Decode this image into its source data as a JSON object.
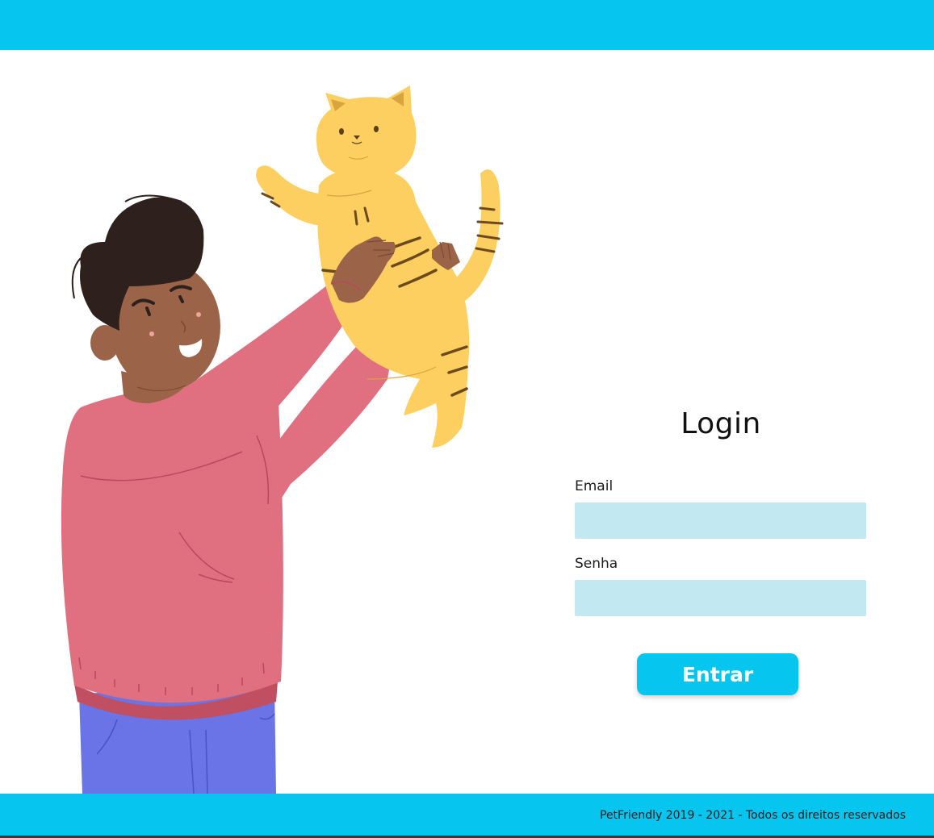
{
  "login": {
    "title": "Login",
    "email_label": "Email",
    "email_value": "",
    "password_label": "Senha",
    "password_value": "",
    "submit_label": "Entrar"
  },
  "footer": {
    "copyright": "PetFriendly 2019 - 2021 - Todos os direitos reservados"
  },
  "colors": {
    "brand": "#06c6f0",
    "input_background": "#c2e8f2",
    "sweater": "#e07080",
    "pants": "#6b74e6",
    "cat": "#fdcf60"
  },
  "illustration": {
    "subject": "man-lifting-cat-illustration"
  }
}
